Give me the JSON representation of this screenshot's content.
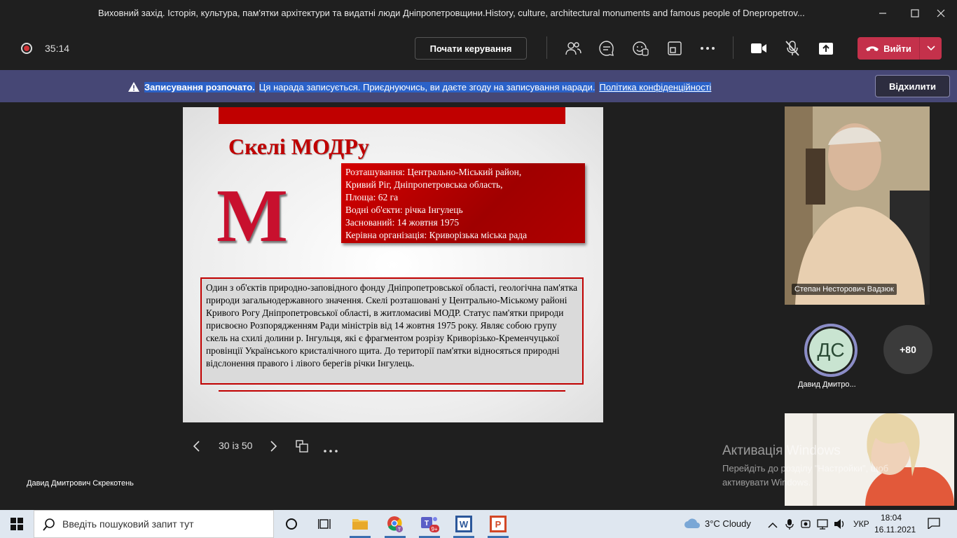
{
  "window": {
    "title": "Виховний захід. Історія, культура, пам'ятки архітектури та видатні люди Дніпропетровщини.History, culture, architectural monuments and famous people of Dnepropetrov..."
  },
  "meeting": {
    "timer": "35:14",
    "take_control_label": "Почати керування",
    "leave_label": "Вийти"
  },
  "banner": {
    "bold": "Записування розпочато.",
    "text": "Ця нарада записується. Приєднуючись, ви даєте згоду на записування наради.",
    "link": "Політика конфіденційності",
    "dismiss_label": "Відхилити"
  },
  "slide": {
    "title": "Скелі МОДРу",
    "letter": "М",
    "info_lines": [
      "Розташування: Центрально-Міський район,",
      "Кривий Ріг, Дніпропетровська область,",
      "Площа: 62 га",
      "Водні об'єкти: річка Інгулець",
      "Заснований: 14 жовтня 1975",
      "Керівна організація: Криворізька міська рада"
    ],
    "description": " Один з об'єктів природно-заповідного фонду Дніпропетровської області, геологічна пам'ятка природи загальнодержавного значення. Скелі розташовані у Центрально-Міському районі Кривого Рогу Дніпропетровської області, в житломасиві МОДР. Статус пам'ятки природи присвоєно Розпорядженням Ради міністрів від 14 жовтня 1975 року. Являє собою групу скель на схилі долини р. Інгульця, які є фрагментом розрізу Криворізько-Кременчуцької провінції Українського кристалічного щита. До території пам'ятки відносяться природні відслонення правого і лівого берегів річки Інгулець."
  },
  "slide_nav": {
    "page_indicator": "30 із 50"
  },
  "presenter": {
    "name": "Давид Дмитрович Скрекотень"
  },
  "participants": {
    "video1_name": "Степан Несторович Вадзюк",
    "avatar_initials": "ДС",
    "avatar_name": "Давид Дмитро...",
    "more_count": "+80"
  },
  "watermark": {
    "title": "Активація Windows",
    "line1": "Перейдіть до розділу \"Настройки\", щоб",
    "line2": "активувати Windows."
  },
  "taskbar": {
    "search_placeholder": "Введіть пошуковий запит тут",
    "teams_badge": "9+",
    "weather": "3°C  Cloudy",
    "lang": "УКР",
    "time": "18:04",
    "date": "16.11.2021"
  }
}
